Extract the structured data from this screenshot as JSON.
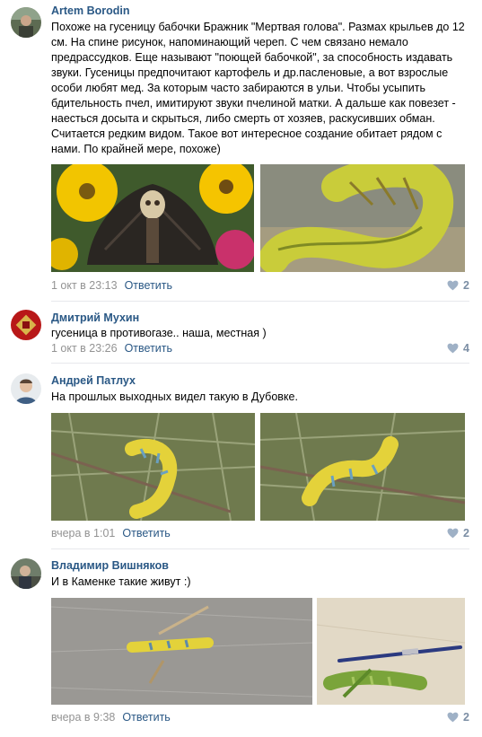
{
  "comments": [
    {
      "author": "Artem Borodin",
      "text": "Похоже на гусеницу бабочки Бражник \"Мертвая голова\". Размах крыльев до 12 см. На спине рисунок, напоминающий череп. С чем связано немало предрассудков. Еще называют \"поющей бабочкой\", за способность издавать звуки. Гусеницы предпочитают картофель и др.пасленовые, а вот взрослые особи любят мед. За которым часто забираются в ульи. Чтобы усыпить бдительность пчел, имитируют звуки пчелиной матки. А дальше как повезет - наесться досыта и скрыться, либо смерть от хозяев, раскусивших обман. Считается редким видом. Такое вот интересное создание обитает рядом с нами. По крайней мере, похоже)",
      "date": "1 окт в 23:13",
      "reply": "Ответить",
      "likes": "2"
    },
    {
      "author": "Дмитрий Мухин",
      "text": "гусеница в противогазе.. наша, местная )",
      "date": "1 окт в 23:26",
      "reply": "Ответить",
      "likes": "4"
    },
    {
      "author": "Андрей Патлух",
      "text": "На прошлых выходных видел такую в Дубовке.",
      "date": "вчера в 1:01",
      "reply": "Ответить",
      "likes": "2"
    },
    {
      "author": "Владимир Вишняков",
      "text": "И в Каменке такие живут :)",
      "date": "вчера в 9:38",
      "reply": "Ответить",
      "likes": "2"
    }
  ],
  "colors": {
    "author": "#2a5885",
    "meta": "#939393",
    "likes": "#7b8ea4",
    "separator": "#e7e8ec"
  },
  "icons": {
    "like": "heart-icon"
  }
}
